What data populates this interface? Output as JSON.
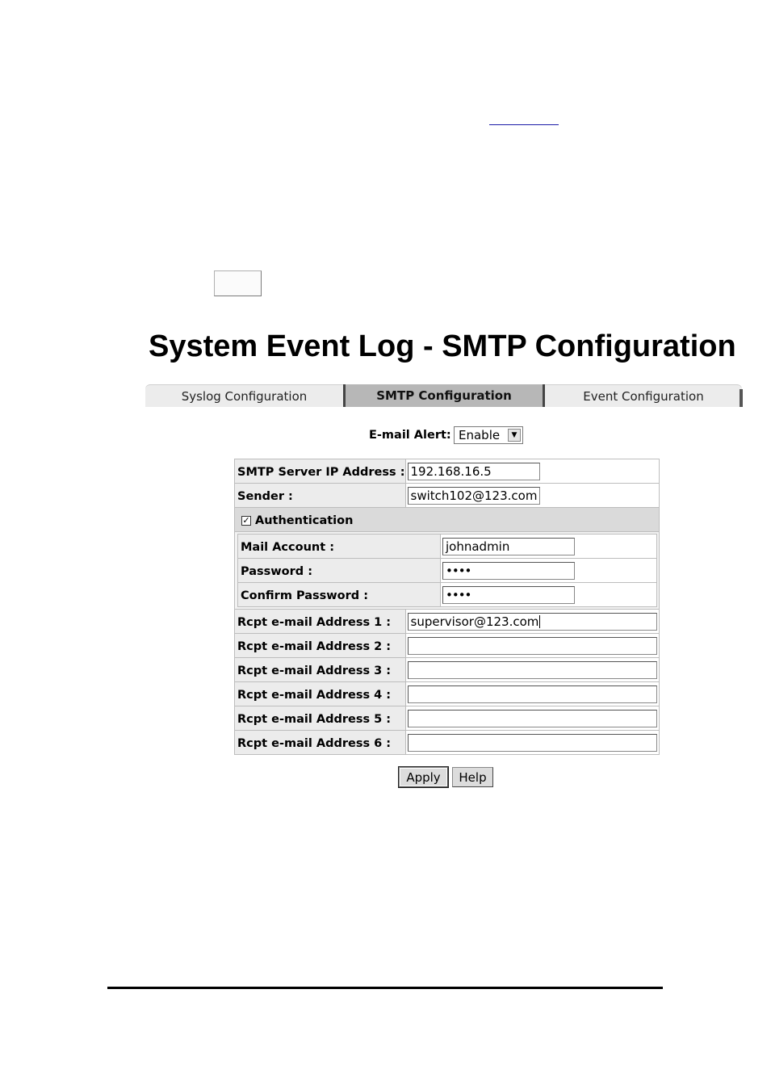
{
  "page": {
    "title": "System Event Log - SMTP Configuration"
  },
  "tabs": [
    {
      "label": "Syslog Configuration"
    },
    {
      "label": "SMTP Configuration"
    },
    {
      "label": "Event Configuration"
    }
  ],
  "email_alert": {
    "label": "E-mail Alert:",
    "value": "Enable"
  },
  "form": {
    "smtp_server": {
      "label": "SMTP Server IP Address :",
      "value": "192.168.16.5"
    },
    "sender": {
      "label": "Sender :",
      "value": "switch102@123.com"
    },
    "authentication": {
      "label": "Authentication",
      "checked": true,
      "check_glyph": "✓"
    },
    "mail_account": {
      "label": "Mail Account :",
      "value": "johnadmin"
    },
    "password": {
      "label": "Password :",
      "value": "••••"
    },
    "confirm_password": {
      "label": "Confirm Password :",
      "value": "••••"
    },
    "rcpt": [
      {
        "label": "Rcpt e-mail Address 1 :",
        "value": "supervisor@123.com"
      },
      {
        "label": "Rcpt e-mail Address 2 :",
        "value": ""
      },
      {
        "label": "Rcpt e-mail Address 3 :",
        "value": ""
      },
      {
        "label": "Rcpt e-mail Address 4 :",
        "value": ""
      },
      {
        "label": "Rcpt e-mail Address 5 :",
        "value": ""
      },
      {
        "label": "Rcpt e-mail Address 6 :",
        "value": ""
      }
    ]
  },
  "buttons": {
    "apply": "Apply",
    "help": "Help"
  },
  "icons": {
    "dropdown": "chevron-down-icon",
    "checkbox": "checkbox-checked-icon"
  }
}
